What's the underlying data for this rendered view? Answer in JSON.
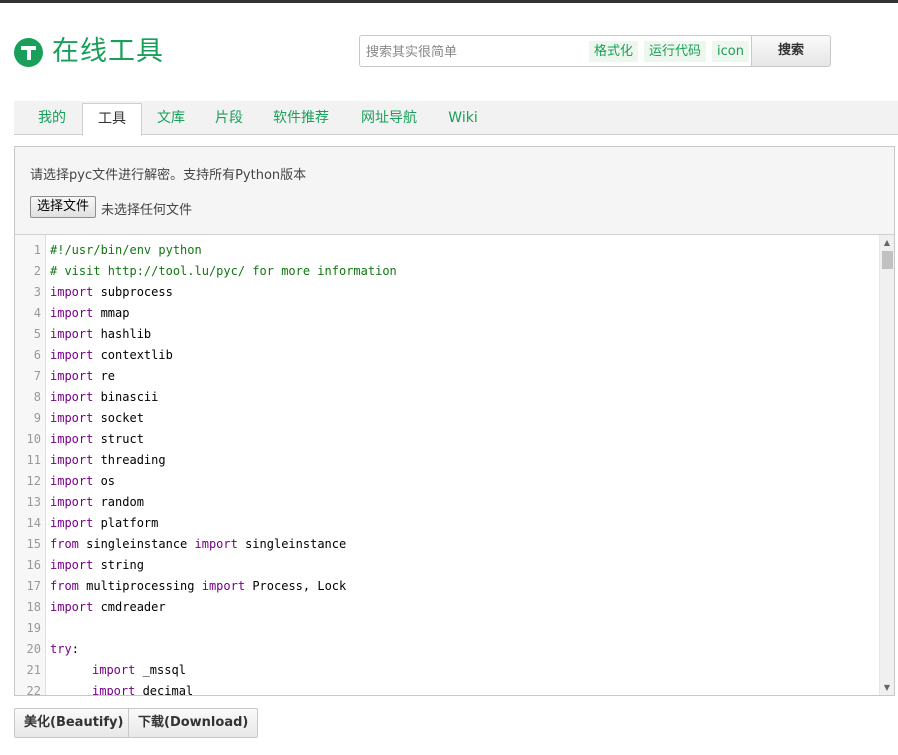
{
  "site": {
    "logo_text": "在线工具"
  },
  "search": {
    "placeholder": "搜索其实很简单",
    "quick_links": [
      "格式化",
      "运行代码",
      "icon"
    ],
    "button_label": "搜索"
  },
  "tabs": [
    {
      "label": "我的",
      "active": false
    },
    {
      "label": "工具",
      "active": true
    },
    {
      "label": "文库",
      "active": false
    },
    {
      "label": "片段",
      "active": false
    },
    {
      "label": "软件推荐",
      "active": false
    },
    {
      "label": "网址导航",
      "active": false
    },
    {
      "label": "Wiki",
      "active": false
    }
  ],
  "panel": {
    "description": "请选择pyc文件进行解密。支持所有Python版本",
    "file_button": "选择文件",
    "file_status": "未选择任何文件"
  },
  "editor": {
    "lines": [
      {
        "n": "1",
        "indent": 0,
        "tokens": [
          [
            "cm",
            "#!/usr/bin/env python"
          ]
        ]
      },
      {
        "n": "2",
        "indent": 0,
        "tokens": [
          [
            "cm",
            "# visit http://tool.lu/pyc/ for more information"
          ]
        ]
      },
      {
        "n": "3",
        "indent": 0,
        "tokens": [
          [
            "kw",
            "import"
          ],
          [
            "tx",
            " subprocess"
          ]
        ]
      },
      {
        "n": "4",
        "indent": 0,
        "tokens": [
          [
            "kw",
            "import"
          ],
          [
            "tx",
            " mmap"
          ]
        ]
      },
      {
        "n": "5",
        "indent": 0,
        "tokens": [
          [
            "kw",
            "import"
          ],
          [
            "tx",
            " hashlib"
          ]
        ]
      },
      {
        "n": "6",
        "indent": 0,
        "tokens": [
          [
            "kw",
            "import"
          ],
          [
            "tx",
            " contextlib"
          ]
        ]
      },
      {
        "n": "7",
        "indent": 0,
        "tokens": [
          [
            "kw",
            "import"
          ],
          [
            "tx",
            " re"
          ]
        ]
      },
      {
        "n": "8",
        "indent": 0,
        "tokens": [
          [
            "kw",
            "import"
          ],
          [
            "tx",
            " binascii"
          ]
        ]
      },
      {
        "n": "9",
        "indent": 0,
        "tokens": [
          [
            "kw",
            "import"
          ],
          [
            "tx",
            " socket"
          ]
        ]
      },
      {
        "n": "10",
        "indent": 0,
        "tokens": [
          [
            "kw",
            "import"
          ],
          [
            "tx",
            " struct"
          ]
        ]
      },
      {
        "n": "11",
        "indent": 0,
        "tokens": [
          [
            "kw",
            "import"
          ],
          [
            "tx",
            " threading"
          ]
        ]
      },
      {
        "n": "12",
        "indent": 0,
        "tokens": [
          [
            "kw",
            "import"
          ],
          [
            "tx",
            " os"
          ]
        ]
      },
      {
        "n": "13",
        "indent": 0,
        "tokens": [
          [
            "kw",
            "import"
          ],
          [
            "tx",
            " random"
          ]
        ]
      },
      {
        "n": "14",
        "indent": 0,
        "tokens": [
          [
            "kw",
            "import"
          ],
          [
            "tx",
            " platform"
          ]
        ]
      },
      {
        "n": "15",
        "indent": 0,
        "tokens": [
          [
            "kw",
            "from"
          ],
          [
            "tx",
            " singleinstance "
          ],
          [
            "kw",
            "import"
          ],
          [
            "tx",
            " singleinstance"
          ]
        ]
      },
      {
        "n": "16",
        "indent": 0,
        "tokens": [
          [
            "kw",
            "import"
          ],
          [
            "tx",
            " string"
          ]
        ]
      },
      {
        "n": "17",
        "indent": 0,
        "tokens": [
          [
            "kw",
            "from"
          ],
          [
            "tx",
            " multiprocessing "
          ],
          [
            "kw",
            "import"
          ],
          [
            "tx",
            " Process, Lock"
          ]
        ]
      },
      {
        "n": "18",
        "indent": 0,
        "tokens": [
          [
            "kw",
            "import"
          ],
          [
            "tx",
            " cmdreader"
          ]
        ]
      },
      {
        "n": "19",
        "indent": 0,
        "tokens": []
      },
      {
        "n": "20",
        "indent": 0,
        "tokens": [
          [
            "kw",
            "try"
          ],
          [
            "tx",
            ":"
          ]
        ]
      },
      {
        "n": "21",
        "indent": 1,
        "tokens": [
          [
            "kw",
            "import"
          ],
          [
            "tx",
            " _mssql"
          ]
        ]
      },
      {
        "n": "22",
        "indent": 1,
        "tokens": [
          [
            "kw",
            "import"
          ],
          [
            "tx",
            " decimal"
          ]
        ]
      }
    ]
  },
  "actions": {
    "beautify": "美化(Beautify)",
    "download": "下载(Download)"
  },
  "colors": {
    "brand": "#1a9f5a",
    "keyword": "#770088",
    "comment": "#117711"
  }
}
